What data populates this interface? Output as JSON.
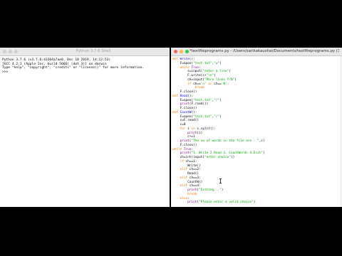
{
  "shell": {
    "title": "Python 3.7.6 Shell",
    "lines": [
      "Python 3.7.6 (v3.7.6:43364a7ae0, Dec 18 2019, 14:12:53)",
      "[GCC 4.2.1 (Apple Inc. build 5666) (dot 3)] on darwin",
      "Type \"help\", \"copyright\", \"credits\" or \"license()\" for more information.",
      ">>> "
    ]
  },
  "editor": {
    "title": "*textfileprograms.py - /Users/sarikakaushal/Documents/textfileprograms.py (3.7.6)*",
    "lines": [
      [
        [
          "k",
          "def "
        ],
        [
          "d",
          "Write"
        ],
        [
          "",
          "():"
        ]
      ],
      [
        [
          "",
          "    F=open("
        ],
        [
          "s",
          "\"test.txt\""
        ],
        [
          "",
          ","
        ],
        [
          "s",
          "\"w\""
        ],
        [
          "",
          ")"
        ]
      ],
      [
        [
          "k",
          "    while "
        ],
        [
          "b",
          "True"
        ],
        [
          "",
          ":"
        ]
      ],
      [
        [
          "",
          "        s=input("
        ],
        [
          "s",
          "\"enter a line\""
        ],
        [
          "",
          ")"
        ]
      ],
      [
        [
          "",
          "        F.write(s+"
        ],
        [
          "s",
          "\"\\n\""
        ],
        [
          "",
          ")"
        ]
      ],
      [
        [
          "",
          "        ch=input("
        ],
        [
          "s",
          "\"More lines Y/N\""
        ],
        [
          "",
          ")"
        ]
      ],
      [
        [
          "k",
          "        if "
        ],
        [
          "",
          "ch=="
        ],
        [
          "s",
          "'n'"
        ],
        [
          "k",
          " or "
        ],
        [
          "",
          "ch=="
        ],
        [
          "s",
          "'N'"
        ],
        [
          "",
          ":"
        ]
      ],
      [
        [
          "k",
          "            break"
        ]
      ],
      [
        [
          "",
          "    F.close()"
        ]
      ],
      [
        [
          "",
          ""
        ]
      ],
      [
        [
          "k",
          "def "
        ],
        [
          "d",
          "Read"
        ],
        [
          "",
          "():"
        ]
      ],
      [
        [
          "",
          "    F=open("
        ],
        [
          "s",
          "\"test.txt\""
        ],
        [
          "",
          ","
        ],
        [
          "s",
          "\"r\""
        ],
        [
          "",
          ")"
        ]
      ],
      [
        [
          "b",
          "    print"
        ],
        [
          "",
          "(F.read())"
        ]
      ],
      [
        [
          "",
          "    F.close()"
        ]
      ],
      [
        [
          "",
          ""
        ]
      ],
      [
        [
          "k",
          "def "
        ],
        [
          "d",
          "CountW"
        ],
        [
          "",
          "():"
        ]
      ],
      [
        [
          "",
          "    F=open("
        ],
        [
          "s",
          "\"test.txt\""
        ],
        [
          "",
          ","
        ],
        [
          "s",
          "\"r\""
        ],
        [
          "",
          ")"
        ]
      ],
      [
        [
          "",
          "    s=F.read()"
        ]
      ],
      [
        [
          "",
          "    c=0"
        ]
      ],
      [
        [
          "k",
          "    for "
        ],
        [
          "",
          "i "
        ],
        [
          "k",
          "in "
        ],
        [
          "",
          "s.split():"
        ]
      ],
      [
        [
          "b",
          "        print"
        ],
        [
          "",
          "(i)"
        ]
      ],
      [
        [
          "",
          "        c+=1"
        ]
      ],
      [
        [
          "b",
          "    print"
        ],
        [
          "",
          "("
        ],
        [
          "s",
          "\"The no of words in the file are : \""
        ],
        [
          "",
          ",c)"
        ]
      ],
      [
        [
          "",
          "    F.close()"
        ]
      ],
      [
        [
          "",
          ""
        ]
      ],
      [
        [
          "k",
          "while "
        ],
        [
          "b",
          "True"
        ],
        [
          "",
          ":"
        ]
      ],
      [
        [
          "b",
          "    print"
        ],
        [
          "",
          "("
        ],
        [
          "s",
          "\"1. Write 2 Read 3. CountWords 4.Exit\""
        ],
        [
          "",
          ")"
        ]
      ],
      [
        [
          "",
          "    ch=int(input("
        ],
        [
          "s",
          "\"enter choice\""
        ],
        [
          "",
          "))"
        ]
      ],
      [
        [
          "k",
          "    if "
        ],
        [
          "",
          "ch==1:"
        ]
      ],
      [
        [
          "",
          "        Write()"
        ]
      ],
      [
        [
          "k",
          "    elif "
        ],
        [
          "",
          "ch==2:"
        ]
      ],
      [
        [
          "",
          "        Read()"
        ]
      ],
      [
        [
          "k",
          "    elif "
        ],
        [
          "",
          "ch==3:"
        ]
      ],
      [
        [
          "",
          "        CountW()"
        ]
      ],
      [
        [
          "k",
          "    elif "
        ],
        [
          "",
          "ch==4:"
        ]
      ],
      [
        [
          "b",
          "        print"
        ],
        [
          "",
          "("
        ],
        [
          "s",
          "\"Exiting...\""
        ],
        [
          "",
          ")"
        ]
      ],
      [
        [
          "k",
          "        break"
        ]
      ],
      [
        [
          "k",
          "    else"
        ],
        [
          "",
          ":"
        ]
      ],
      [
        [
          "b",
          "        print"
        ],
        [
          "",
          "("
        ],
        [
          "s",
          "\"Please enter a valid choice\""
        ],
        [
          "",
          ")"
        ]
      ]
    ]
  }
}
